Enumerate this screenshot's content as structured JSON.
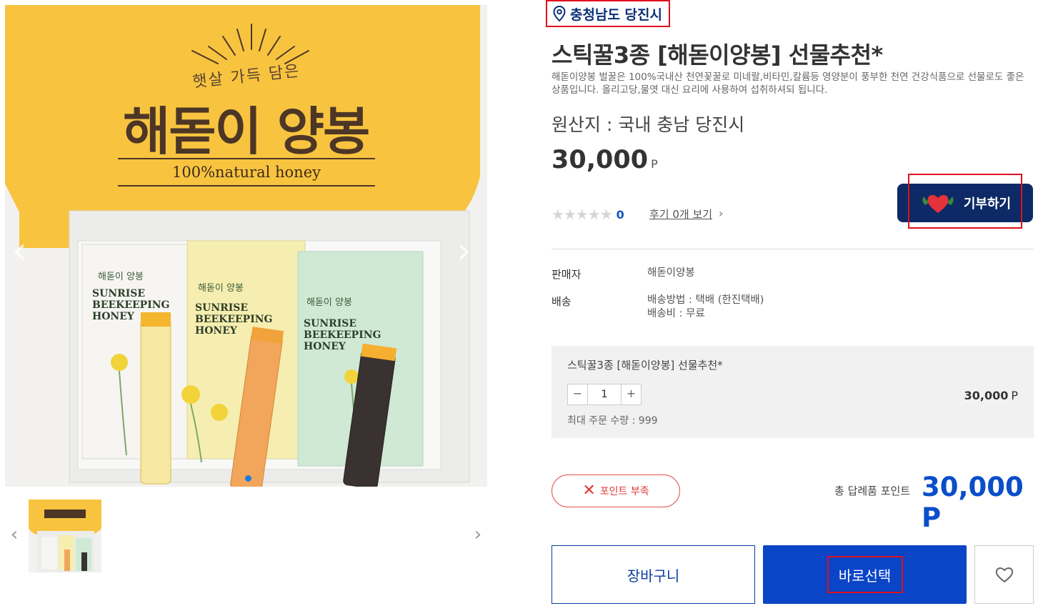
{
  "location": {
    "text": "충청남도 당진시"
  },
  "product": {
    "title": "스틱꿀3종 [해돋이양봉] 선물추천*",
    "description": "해돋이양봉 벌꿀은 100%국내산 천연꽃꿀로 미네랄,비타민,칼륨등 영양분이 풍부한 천연 건강식품으로 선물로도 좋은 상품입니다. 올리고당,물엿 대신 요리에 사용하여 섭취하셔되 됩니다.",
    "origin": "원산지 : 국내 충남 당진시",
    "price": "30,000",
    "price_unit": "P",
    "rating_count": "0",
    "review_link": "후기 0개 보기",
    "stars": "★★★★★"
  },
  "donate": {
    "label": "기부하기"
  },
  "hero": {
    "sub": "햇살 가득 담은",
    "title": "해돋이 양봉",
    "eng": "100%natural honey"
  },
  "info": {
    "seller_label": "판매자",
    "seller_value": "해돋이양봉",
    "shipping_label": "배송",
    "shipping_method": "배송방법 : 택배 (한진택배)",
    "shipping_fee": "배송비 : 무료"
  },
  "option": {
    "name": "스틱꿀3종 [해돋이양봉] 선물추천*",
    "minus": "−",
    "qty": "1",
    "plus": "+",
    "max": "최대 주문 수량 : 999",
    "price": "30,000",
    "unit": "P"
  },
  "points": {
    "badge_label": "포인트 부족"
  },
  "total": {
    "label": "총 답례품 포인트",
    "value": "30,000 P"
  },
  "buttons": {
    "cart": "장바구니",
    "buy": "바로선택"
  },
  "colors": {
    "brand": "#0a44c7",
    "donate": "#0d2a66",
    "highlight": "#e0101c",
    "hero_yellow": "#f8c440"
  }
}
